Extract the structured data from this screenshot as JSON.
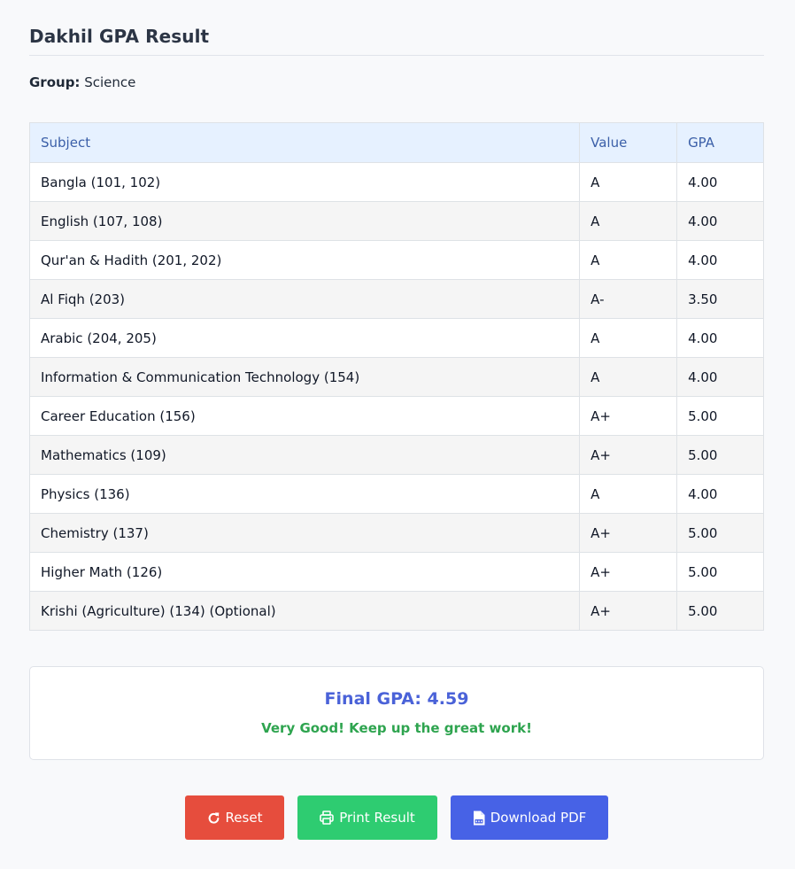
{
  "header": {
    "title": "Dakhil GPA Result"
  },
  "group": {
    "label": "Group:",
    "value": "Science"
  },
  "table": {
    "columns": [
      "Subject",
      "Value",
      "GPA"
    ],
    "rows": [
      {
        "subject": "Bangla (101, 102)",
        "value": "A",
        "gpa": "4.00"
      },
      {
        "subject": "English (107, 108)",
        "value": "A",
        "gpa": "4.00"
      },
      {
        "subject": "Qur'an & Hadith (201, 202)",
        "value": "A",
        "gpa": "4.00"
      },
      {
        "subject": "Al Fiqh (203)",
        "value": "A-",
        "gpa": "3.50"
      },
      {
        "subject": "Arabic (204, 205)",
        "value": "A",
        "gpa": "4.00"
      },
      {
        "subject": "Information & Communication Technology (154)",
        "value": "A",
        "gpa": "4.00"
      },
      {
        "subject": "Career Education (156)",
        "value": "A+",
        "gpa": "5.00"
      },
      {
        "subject": "Mathematics (109)",
        "value": "A+",
        "gpa": "5.00"
      },
      {
        "subject": "Physics (136)",
        "value": "A",
        "gpa": "4.00"
      },
      {
        "subject": "Chemistry (137)",
        "value": "A+",
        "gpa": "5.00"
      },
      {
        "subject": "Higher Math (126)",
        "value": "A+",
        "gpa": "5.00"
      },
      {
        "subject": "Krishi (Agriculture) (134) (Optional)",
        "value": "A+",
        "gpa": "5.00"
      }
    ]
  },
  "result": {
    "final_gpa": "Final GPA: 4.59",
    "message": "Very Good! Keep up the great work!"
  },
  "actions": {
    "reset_label": "Reset",
    "reset_icon": "redo-icon",
    "print_label": "Print Result",
    "print_icon": "printer-icon",
    "pdf_label": "Download PDF",
    "pdf_icon": "pdf-file-icon"
  },
  "colors": {
    "reset": "#e64d3d",
    "print": "#2ecc71",
    "pdf": "#4762e6",
    "gpa_text": "#4a62d8",
    "message_text": "#2ea44f"
  }
}
